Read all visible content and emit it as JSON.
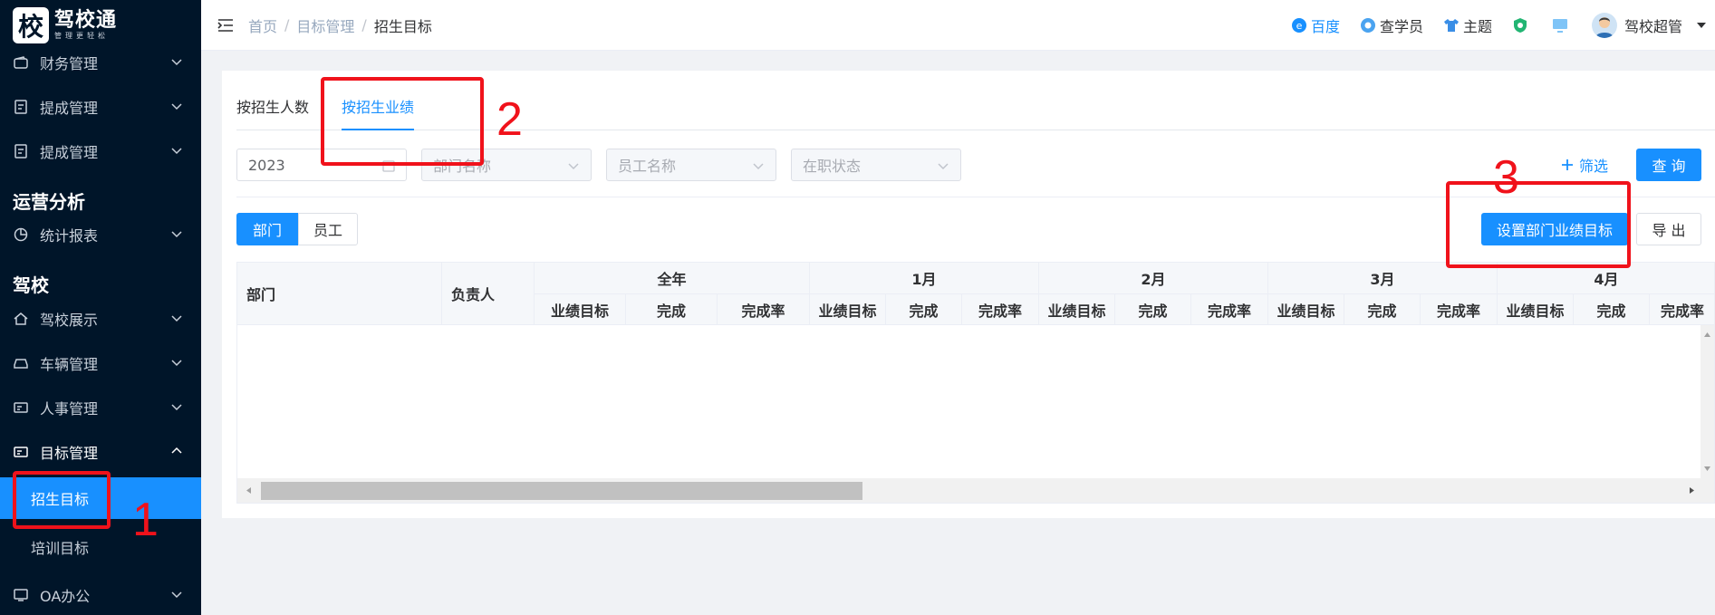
{
  "app": {
    "logo_glyph": "校",
    "logo_title": "驾校通",
    "logo_subtitle": "管理更轻松"
  },
  "sidebar": {
    "items": [
      {
        "label": "财务管理",
        "icon": "wallet-icon"
      },
      {
        "label": "提成管理",
        "icon": "document-icon"
      },
      {
        "label": "提成管理",
        "icon": "document-icon"
      }
    ],
    "group_ops": "运营分析",
    "ops_items": [
      {
        "label": "统计报表",
        "icon": "pie-chart-icon"
      }
    ],
    "group_school": "驾校",
    "school_items": [
      {
        "label": "驾校展示",
        "icon": "home-icon"
      },
      {
        "label": "车辆管理",
        "icon": "car-icon"
      },
      {
        "label": "人事管理",
        "icon": "id-card-icon"
      },
      {
        "label": "目标管理",
        "icon": "target-icon"
      }
    ],
    "sub_items": [
      {
        "label": "招生目标",
        "active": true
      },
      {
        "label": "培训目标",
        "active": false
      }
    ],
    "last_item": {
      "label": "OA办公",
      "icon": "oa-icon"
    }
  },
  "header": {
    "breadcrumb": [
      "首页",
      "目标管理",
      "招生目标"
    ],
    "links": [
      {
        "label": "百度",
        "icon": "browser-icon"
      },
      {
        "label": "查学员",
        "icon": "search-student-icon"
      },
      {
        "label": "主题",
        "icon": "shirt-icon"
      }
    ],
    "username": "驾校超管"
  },
  "tabs": [
    {
      "label": "按招生人数",
      "active": false
    },
    {
      "label": "按招生业绩",
      "active": true
    }
  ],
  "filters": {
    "year": "2023",
    "department_placeholder": "部门名称",
    "employee_placeholder": "员工名称",
    "status_placeholder": "在职状态",
    "filter_label": "筛选",
    "query_label": "查 询"
  },
  "toggle": {
    "department": "部门",
    "employee": "员工"
  },
  "actions": {
    "set_target": "设置部门业绩目标",
    "export": "导 出"
  },
  "table": {
    "col_department": "部门",
    "col_owner": "负责人",
    "groups": [
      "全年",
      "1月",
      "2月",
      "3月",
      "4月"
    ],
    "sub_cols": [
      "业绩目标",
      "完成",
      "完成率"
    ]
  },
  "annotations": [
    "1",
    "2",
    "3"
  ],
  "colors": {
    "sidebar_bg": "#001529",
    "accent": "#1890ff",
    "annotation": "#f0121b"
  }
}
